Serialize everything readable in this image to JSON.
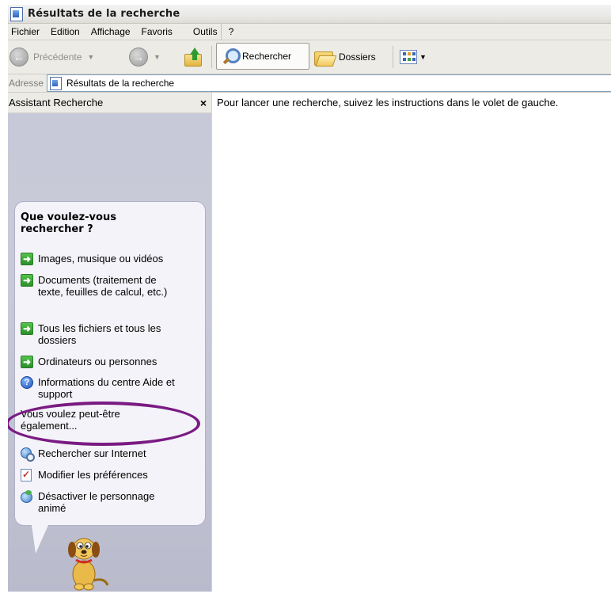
{
  "window": {
    "title": "Résultats de la recherche"
  },
  "menu": {
    "items": [
      "Fichier",
      "Edition",
      "Affichage",
      "Favoris",
      "Outils",
      "?"
    ]
  },
  "toolbar": {
    "back_label": "Précédente",
    "search_label": "Rechercher",
    "folders_label": "Dossiers"
  },
  "address": {
    "label": "Adresse",
    "value": "Résultats de la recherche"
  },
  "search_pane": {
    "title": "Assistant Recherche",
    "close_glyph": "×",
    "heading": "Que voulez-vous rechercher ?",
    "options": [
      {
        "label": "Images, musique ou vidéos",
        "icon": "green-arrow-icon"
      },
      {
        "label": "Documents (traitement de texte, feuilles de calcul, etc.)",
        "icon": "green-arrow-icon"
      },
      {
        "label": "Tous les fichiers et tous les dossiers",
        "icon": "green-arrow-icon",
        "highlighted": true
      },
      {
        "label": "Ordinateurs ou personnes",
        "icon": "green-arrow-icon"
      },
      {
        "label": "Informations du centre Aide et support",
        "icon": "help-icon"
      }
    ],
    "more_heading": "Vous voulez peut-être également...",
    "more_options": [
      {
        "label": "Rechercher sur Internet",
        "icon": "internet-search-icon"
      },
      {
        "label": "Modifier les préférences",
        "icon": "preferences-icon"
      },
      {
        "label": "Désactiver le personnage animé",
        "icon": "animated-character-icon"
      }
    ],
    "highlight_color": "#7a1b82"
  },
  "content": {
    "message": "Pour lancer une recherche, suivez les instructions dans le volet de gauche."
  }
}
